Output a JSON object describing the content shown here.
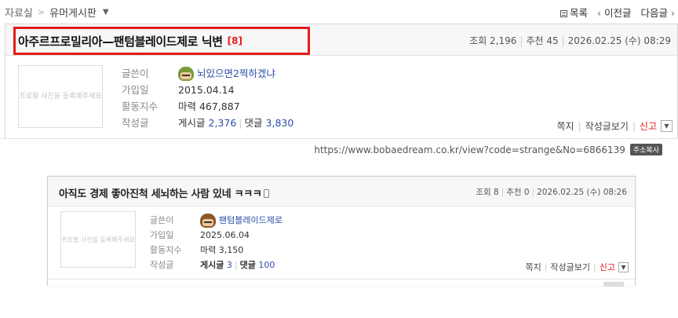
{
  "breadcrumb": {
    "root": "자료실",
    "separator": ">",
    "current": "유머게시판"
  },
  "nav": {
    "list": "목록",
    "prev": "이전글",
    "next": "다음글"
  },
  "post": {
    "title": "아주르프로밀리아—팬텀블레이드제로 닉변",
    "reply_count": "[8]",
    "views": "조회 2,196",
    "recommend": "추천 45",
    "date": "2026.02.25 (수) 08:29"
  },
  "author": {
    "photo_placeholder": "프로필 사진을 등록해주세요",
    "labels": {
      "writer": "글쓴이",
      "joined": "가입일",
      "activity": "활동지수",
      "posts": "작성글"
    },
    "nickname": "뇌있으면2찍하겠냐",
    "joined": "2015.04.14",
    "activity": "마력 467,887",
    "posts_label": "게시글",
    "posts_count": "2,376",
    "comments_label": "댓글",
    "comments_count": "3,830"
  },
  "actions": {
    "message": "쪽지",
    "view_posts": "작성글보기",
    "report": "신고"
  },
  "url": {
    "text": "https://www.bobaedream.co.kr/view?code=strange&No=6866139",
    "copy": "주소복사"
  },
  "embedded": {
    "title": "아직도 경제 좋아진척 세뇌하는 사람 있네 ㅋㅋㅋ",
    "views": "조회 8",
    "recommend": "추천 0",
    "date": "2026.02.25 (수) 08:26",
    "photo_placeholder": "프로필 사진을 등록해주세요",
    "nickname": "팬텀블레이드제로",
    "joined": "2025.06.04",
    "activity": "마력 3,150",
    "posts_label": "게시글",
    "posts_count": "3",
    "comments_label": "댓글",
    "comments_count": "100"
  },
  "colors": {
    "accent_red": "#e21c1c",
    "link_blue": "#2a4ea8"
  }
}
